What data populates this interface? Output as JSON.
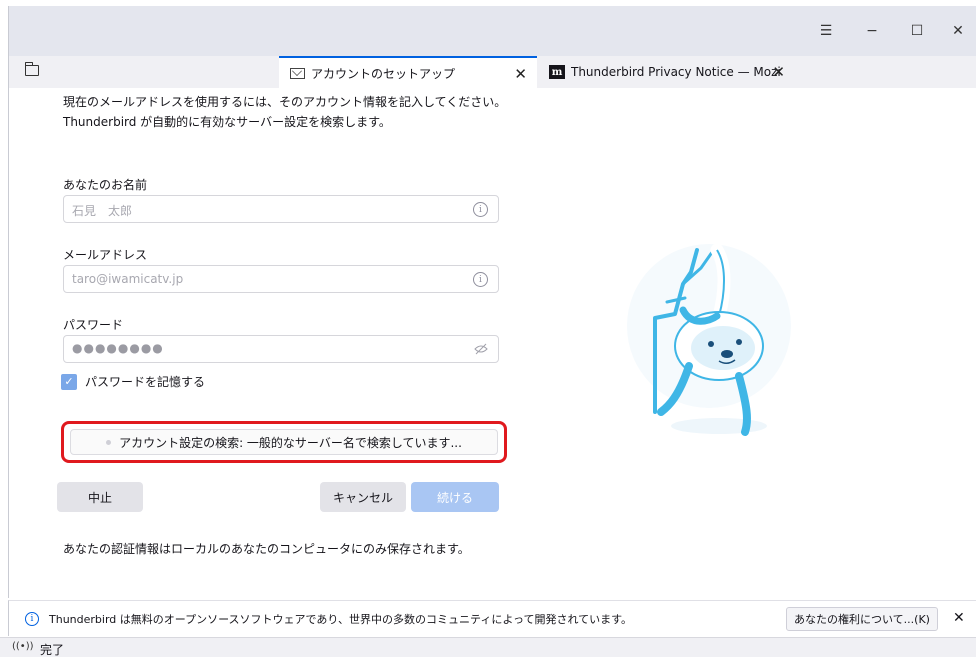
{
  "window": {
    "menu_icon": "hamburger-icon",
    "minimize_icon": "minimize-icon",
    "maximize_icon": "maximize-icon",
    "close_icon": "close-icon"
  },
  "tabs": [
    {
      "label": "アカウントのセットアップ",
      "icon": "mail-setup-icon",
      "active": true
    },
    {
      "label": "Thunderbird Privacy Notice — Mozi",
      "icon": "mozilla-m-icon",
      "active": false
    }
  ],
  "intro": {
    "line1": "現在のメールアドレスを使用するには、そのアカウント情報を記入してください。",
    "line2": "Thunderbird が自動的に有効なサーバー設定を検索します。"
  },
  "form": {
    "name_label": "あなたのお名前",
    "name_value": "石見　太郎",
    "email_label": "メールアドレス",
    "email_value": "taro@iwamicatv.jp",
    "password_label": "パスワード",
    "password_value": "●●●●●●●●",
    "remember_label": "パスワードを記憶する",
    "remember_checked": true
  },
  "status": {
    "text": "アカウント設定の検索: 一般的なサーバー名で検索しています..."
  },
  "buttons": {
    "stop": "中止",
    "cancel": "キャンセル",
    "continue": "続ける"
  },
  "footnote": "あなたの認証情報はローカルのあなたのコンピュータにのみ保存されます。",
  "notification": {
    "text": "Thunderbird は無料のオープンソースソフトウェアであり、世界中の多数のコミュニティによって開発されています。",
    "button": "あなたの権利について...(K)"
  },
  "statusbar": {
    "text": "完了"
  },
  "colors": {
    "accent": "#0061e0",
    "highlight_box": "#e0191e",
    "continue_disabled": "#a9c6f3",
    "sloth_blue": "#3fb6e6"
  }
}
